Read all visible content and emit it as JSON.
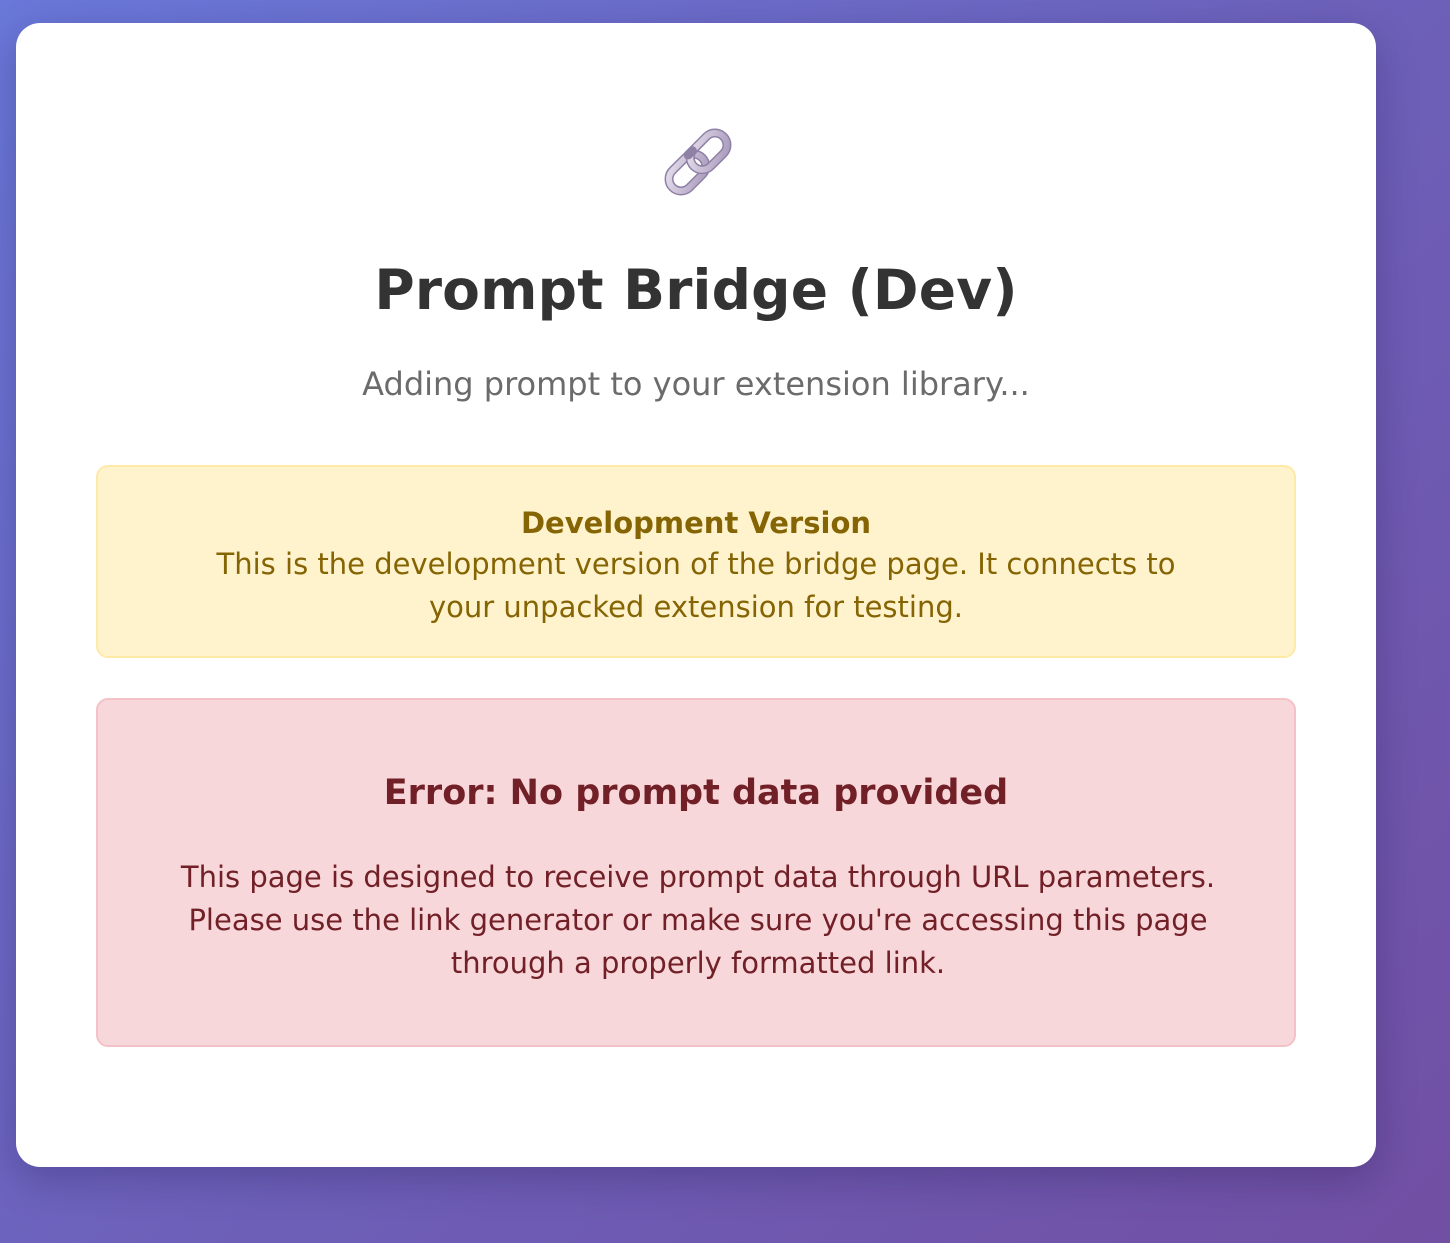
{
  "app": {
    "icon": "link-icon",
    "title": "Prompt Bridge (Dev)",
    "subtitle": "Adding prompt to your extension library..."
  },
  "dev_notice": {
    "title": "Development Version",
    "text": "This is the development version of the bridge page. It connects to your unpacked extension for testing."
  },
  "error": {
    "title": "Error: No prompt data provided",
    "text": "This page is designed to receive prompt data through URL parameters. Please use the link generator or make sure you're accessing this page through a properly formatted link."
  },
  "colors": {
    "notice_bg": "#fff3cd",
    "notice_text": "#856404",
    "error_bg": "#f8d7da",
    "error_text": "#722028"
  }
}
